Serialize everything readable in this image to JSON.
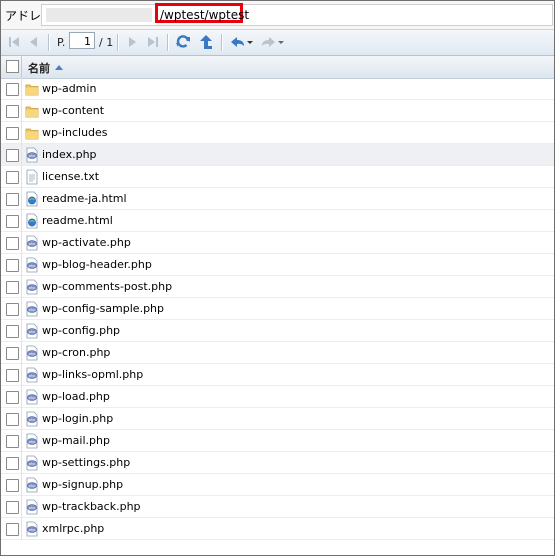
{
  "address": {
    "label": "アドレス:",
    "value": "/wptest/wptest"
  },
  "toolbar": {
    "page_prefix": "P.",
    "page_current": "1",
    "page_total": "/ 1",
    "buttons": [
      "first-page-icon",
      "prev-page-icon",
      "next-page-icon",
      "last-page-icon",
      "refresh-icon",
      "up-folder-icon",
      "undo-menu-icon",
      "redo-menu-icon"
    ]
  },
  "table": {
    "header_label": "名前"
  },
  "files": [
    {
      "name": "wp-admin",
      "type": "folder"
    },
    {
      "name": "wp-content",
      "type": "folder"
    },
    {
      "name": "wp-includes",
      "type": "folder"
    },
    {
      "name": "index.php",
      "type": "php",
      "selected": true
    },
    {
      "name": "license.txt",
      "type": "text"
    },
    {
      "name": "readme-ja.html",
      "type": "html"
    },
    {
      "name": "readme.html",
      "type": "html"
    },
    {
      "name": "wp-activate.php",
      "type": "php"
    },
    {
      "name": "wp-blog-header.php",
      "type": "php"
    },
    {
      "name": "wp-comments-post.php",
      "type": "php"
    },
    {
      "name": "wp-config-sample.php",
      "type": "php"
    },
    {
      "name": "wp-config.php",
      "type": "php"
    },
    {
      "name": "wp-cron.php",
      "type": "php"
    },
    {
      "name": "wp-links-opml.php",
      "type": "php"
    },
    {
      "name": "wp-load.php",
      "type": "php"
    },
    {
      "name": "wp-login.php",
      "type": "php"
    },
    {
      "name": "wp-mail.php",
      "type": "php"
    },
    {
      "name": "wp-settings.php",
      "type": "php"
    },
    {
      "name": "wp-signup.php",
      "type": "php"
    },
    {
      "name": "wp-trackback.php",
      "type": "php"
    },
    {
      "name": "xmlrpc.php",
      "type": "php"
    }
  ],
  "colors": {
    "highlight_border": "#e8000b",
    "toolbar_icon_blue": "#3a78c3",
    "folder_yellow": "#f2c55c"
  }
}
